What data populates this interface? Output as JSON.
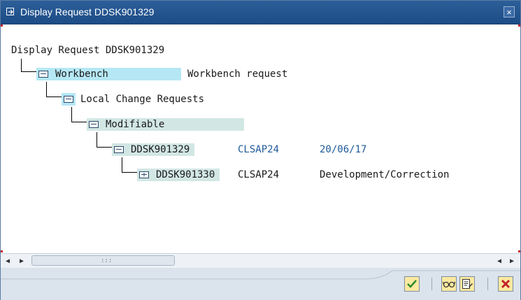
{
  "window": {
    "title": "Display Request DDSK901329",
    "close_glyph": "×"
  },
  "tree": {
    "root": "Display Request DDSK901329",
    "nodes": [
      {
        "label": "Workbench",
        "col1": "Workbench request",
        "col2": "",
        "col3": ""
      },
      {
        "label": "Local Change Requests",
        "col1": "",
        "col2": "",
        "col3": ""
      },
      {
        "label": "Modifiable",
        "col1": "",
        "col2": "",
        "col3": ""
      },
      {
        "label": "DDSK901329",
        "col1": "",
        "col2": "CLSAP24",
        "col3": "20/06/17"
      },
      {
        "label": "DDSK901330",
        "col1": "",
        "col2": "CLSAP24",
        "col3": "Development/Correction"
      }
    ]
  },
  "scrollbar": {
    "left_arrow": "◀",
    "right_arrow": "▶",
    "grip": ":::"
  },
  "toolbar": {
    "confirm_icon": "checkmark-icon",
    "cancel_icon": "cancel-icon"
  },
  "colors": {
    "titlebar": "#1d4c86",
    "highlight_blue": "#b5e7f4",
    "highlight_gray": "#d2e7e4",
    "link_blue": "#1f5a99",
    "cancel_red": "#c4222c"
  }
}
